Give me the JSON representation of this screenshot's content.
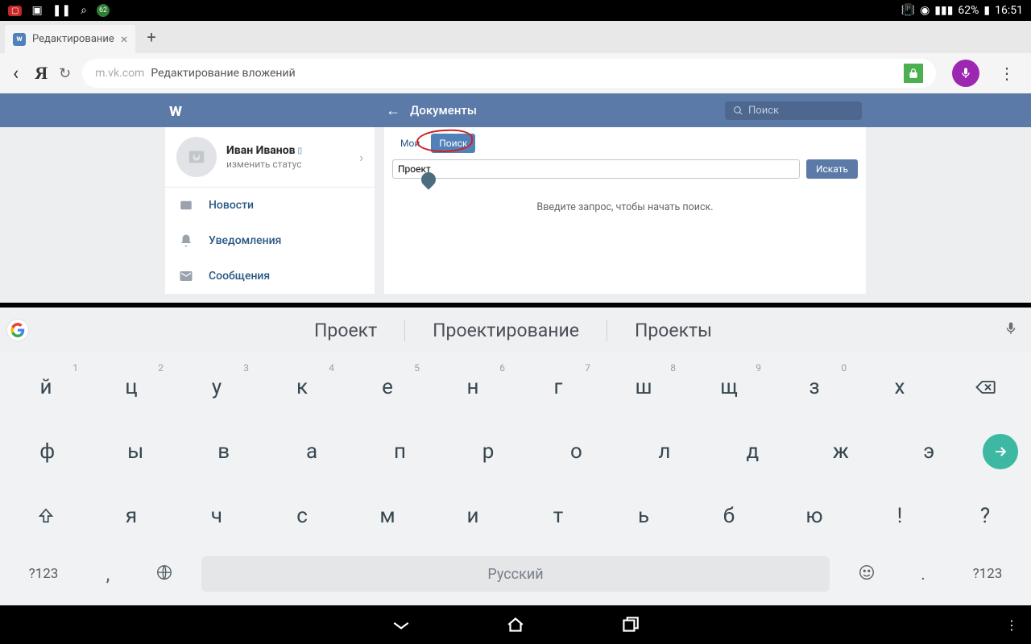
{
  "status": {
    "battery": "62%",
    "time": "16:51"
  },
  "browser": {
    "tab_title": "Редактирование",
    "url_domain": "m.vk.com",
    "url_title": "Редактирование вложений"
  },
  "vk": {
    "header_title": "Документы",
    "search_placeholder": "Поиск",
    "profile": {
      "name": "Иван Иванов",
      "status": "изменить статус"
    },
    "nav": {
      "news": "Новости",
      "notifications": "Уведомления",
      "messages": "Сообщения"
    },
    "tabs": {
      "my": "Мои",
      "search": "Поиск"
    },
    "search_value": "Проект",
    "search_button": "Искать",
    "hint": "Введите запрос, чтобы начать поиск."
  },
  "keyboard": {
    "suggestions": [
      "Проект",
      "Проектирование",
      "Проекты"
    ],
    "row1": [
      {
        "k": "й",
        "n": "1"
      },
      {
        "k": "ц",
        "n": "2"
      },
      {
        "k": "у",
        "n": "3"
      },
      {
        "k": "к",
        "n": "4"
      },
      {
        "k": "е",
        "n": "5"
      },
      {
        "k": "н",
        "n": "6"
      },
      {
        "k": "г",
        "n": "7"
      },
      {
        "k": "ш",
        "n": "8"
      },
      {
        "k": "щ",
        "n": "9"
      },
      {
        "k": "з",
        "n": "0"
      },
      {
        "k": "х",
        "n": ""
      }
    ],
    "row2": [
      "ф",
      "ы",
      "в",
      "а",
      "п",
      "р",
      "о",
      "л",
      "д",
      "ж",
      "э"
    ],
    "row3": [
      "я",
      "ч",
      "с",
      "м",
      "и",
      "т",
      "ь",
      "б",
      "ю",
      "!",
      "?"
    ],
    "fn": "?123",
    "space": "Русский"
  }
}
